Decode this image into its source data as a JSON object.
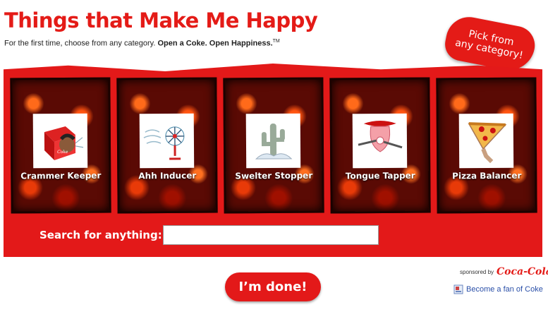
{
  "header": {
    "title": "Things that Make Me Happy",
    "subtitle_plain": "For the first time, choose from any category. ",
    "subtitle_bold": "Open a Coke. Open Happiness.",
    "subtitle_tm": "TM"
  },
  "badge": {
    "line1": "Pick from",
    "line2": "any category!"
  },
  "cards": [
    {
      "label": "Crammer Keeper"
    },
    {
      "label": "Ahh Inducer"
    },
    {
      "label": "Swelter Stopper"
    },
    {
      "label": "Tongue Tapper"
    },
    {
      "label": "Pizza Balancer"
    }
  ],
  "search": {
    "label": "Search for anything:",
    "value": "",
    "placeholder": ""
  },
  "done_button": {
    "label": "I’m done!"
  },
  "sponsor": {
    "text": "sponsored by",
    "brand": "Coca-Cola"
  },
  "fan_link": {
    "label": "Become a fan of Coke"
  },
  "colors": {
    "brand_red": "#e31919",
    "link_blue": "#2a4fa8"
  }
}
